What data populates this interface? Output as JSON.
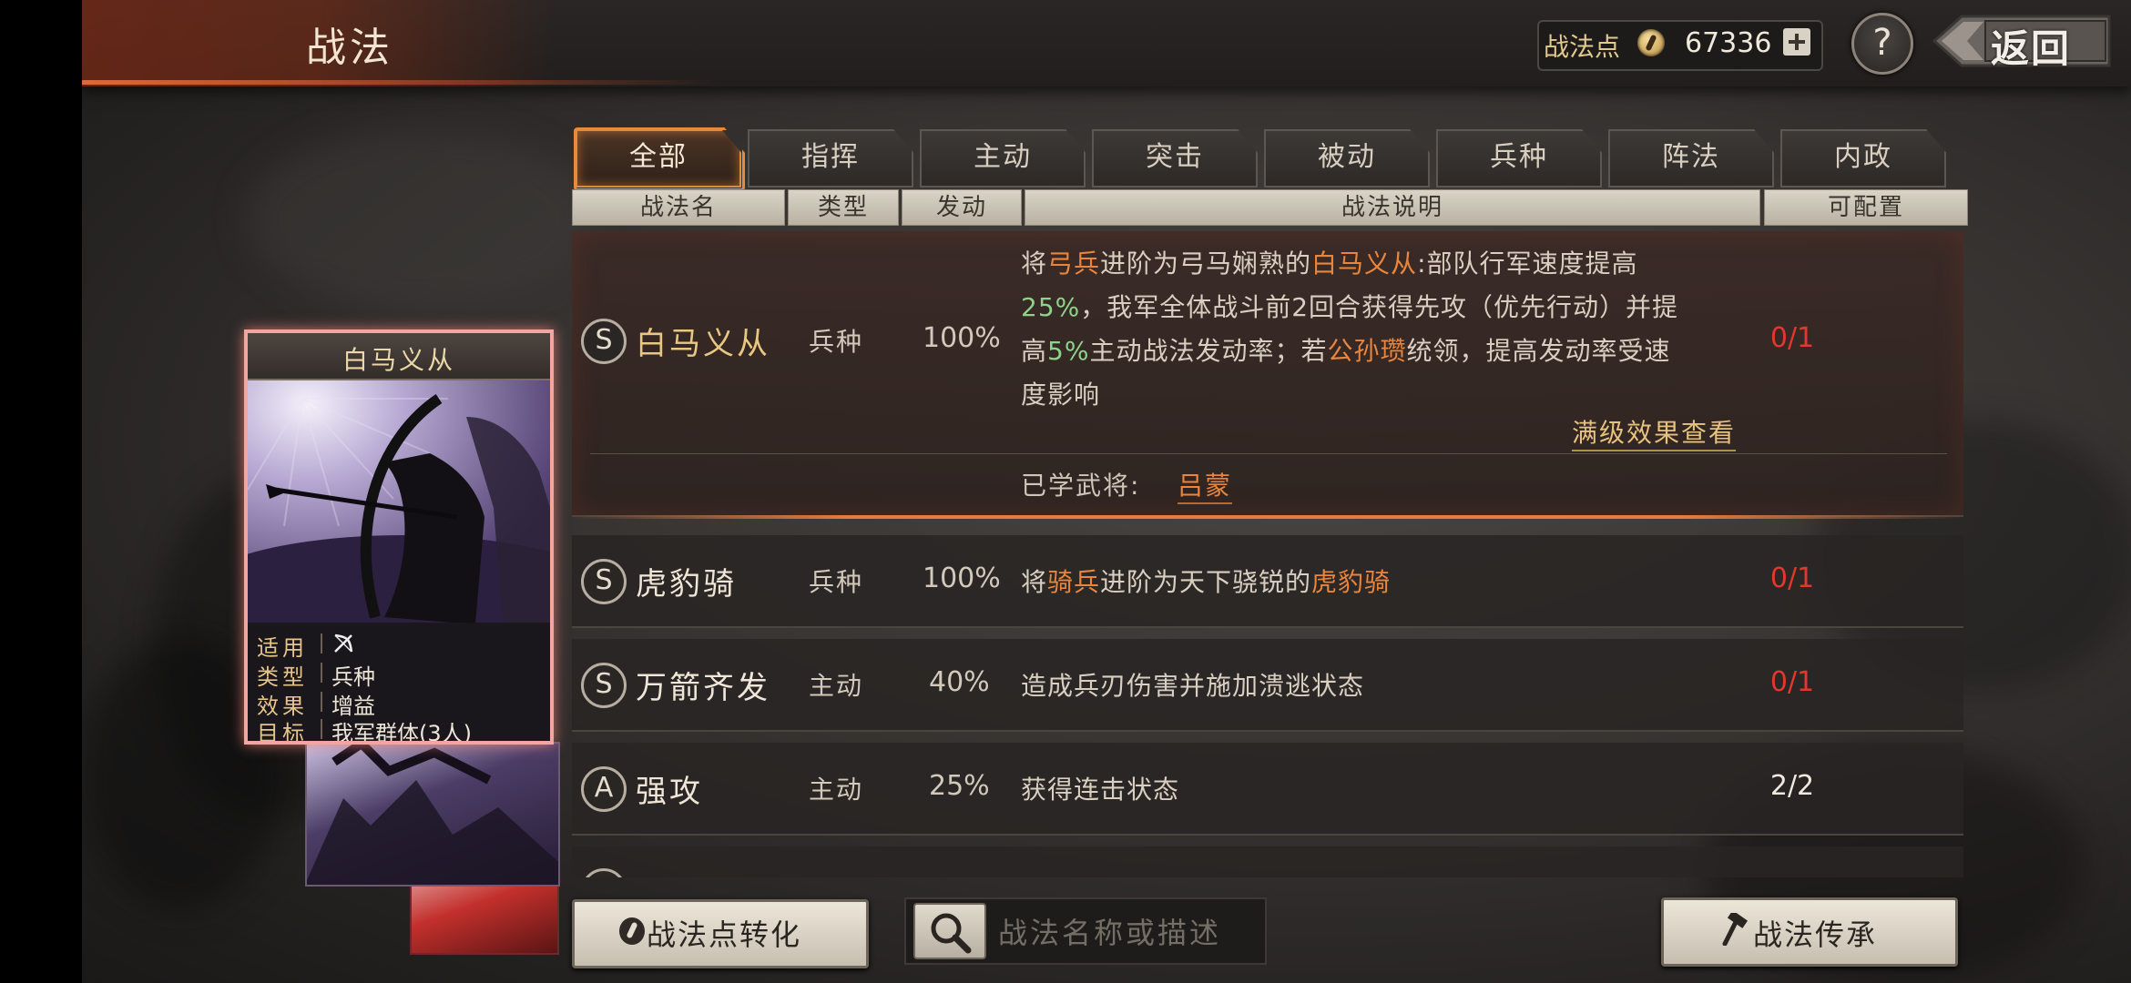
{
  "header": {
    "title": "战法",
    "points_label": "战法点",
    "points_value": "67336",
    "help_label": "?",
    "back_label": "返回"
  },
  "tabs": [
    {
      "label": "全部",
      "active": true
    },
    {
      "label": "指挥"
    },
    {
      "label": "主动"
    },
    {
      "label": "突击"
    },
    {
      "label": "被动"
    },
    {
      "label": "兵种"
    },
    {
      "label": "阵法"
    },
    {
      "label": "内政"
    }
  ],
  "columns": {
    "name": "战法名",
    "type": "类型",
    "rate": "发动",
    "desc": "战法说明",
    "count": "可配置"
  },
  "rows": [
    {
      "grade": "S",
      "name": "白马义从",
      "type": "兵种",
      "rate": "100%",
      "count": "0/1",
      "desc_parts": {
        "l1a": "将",
        "l1b": "弓兵",
        "l1c": "进阶为弓马娴熟的",
        "l1d": "白马义从",
        "l1e": ":部队行军速度提高",
        "l2a": "25%",
        "l2b": "，我军全体战斗前2回合获得先攻（优先行动）并提",
        "l3a": "高",
        "l3b": "5%",
        "l3c": "主动战法发动率；若",
        "l3d": "公孙瓒",
        "l3e": "统领，提高发动率受速",
        "l4": "度影响"
      },
      "full_effect_link": "满级效果查看",
      "learned_label": "已学武将:",
      "learned_general": "吕蒙"
    },
    {
      "grade": "S",
      "name": "虎豹骑",
      "type": "兵种",
      "rate": "100%",
      "count": "0/1",
      "desc_parts": {
        "a": "将",
        "b": "骑兵",
        "c": "进阶为天下骁锐的",
        "d": "虎豹骑"
      }
    },
    {
      "grade": "S",
      "name": "万箭齐发",
      "type": "主动",
      "rate": "40%",
      "count": "0/1",
      "desc": "造成兵刃伤害并施加溃逃状态"
    },
    {
      "grade": "A",
      "name": "强攻",
      "type": "主动",
      "rate": "25%",
      "count": "2/2",
      "desc": "获得连击状态"
    }
  ],
  "card": {
    "title": "白马义从",
    "info": [
      {
        "key": "适用",
        "value": "",
        "icon": "bow-crossed-icon"
      },
      {
        "key": "类型",
        "value": "兵种"
      },
      {
        "key": "效果",
        "value": "增益"
      },
      {
        "key": "目标",
        "value": "我军群体(3人)"
      }
    ]
  },
  "footer": {
    "convert_label": "战法点转化",
    "search_placeholder": "战法名称或描述",
    "inherit_label": "战法传承"
  },
  "colors": {
    "accent_orange": "#e9853c",
    "count_red": "#e0382c",
    "gold": "#e8c781",
    "green": "#8fd38a"
  }
}
